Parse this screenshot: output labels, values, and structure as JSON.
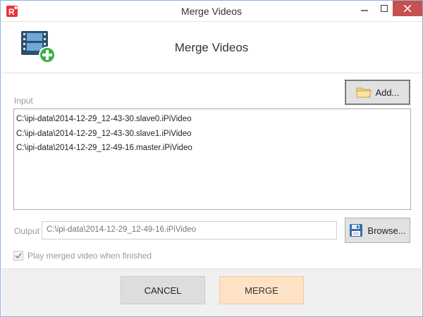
{
  "window": {
    "title": "Merge Videos",
    "minimize_icon": "minimize-icon",
    "maximize_icon": "maximize-icon",
    "close_icon": "close-icon",
    "app_icon": "app-logo-icon",
    "app_logo_text": "R"
  },
  "header": {
    "title": "Merge Videos",
    "icon": "film-add-icon"
  },
  "input": {
    "label": "Input",
    "add_button_label": "Add...",
    "add_button_icon": "folder-icon",
    "files": [
      "C:\\ipi-data\\2014-12-29_12-43-30.slave0.iPiVideo",
      "C:\\ipi-data\\2014-12-29_12-43-30.slave1.iPiVideo",
      "C:\\ipi-data\\2014-12-29_12-49-16.master.iPiVideo"
    ]
  },
  "output": {
    "label": "Output",
    "value": "C:\\ipi-data\\2014-12-29_12-49-16.iPiVideo",
    "browse_button_label": "Browse...",
    "browse_button_icon": "floppy-disk-icon"
  },
  "options": {
    "play_when_finished_label": "Play merged video when finished",
    "play_when_finished_checked": true
  },
  "footer": {
    "cancel_label": "CANCEL",
    "merge_label": "MERGE"
  },
  "colors": {
    "merge_button_bg": "#fde2c6",
    "cancel_button_bg": "#dddddd",
    "close_button_bg": "#c75050",
    "accent_green": "#3cb043"
  }
}
